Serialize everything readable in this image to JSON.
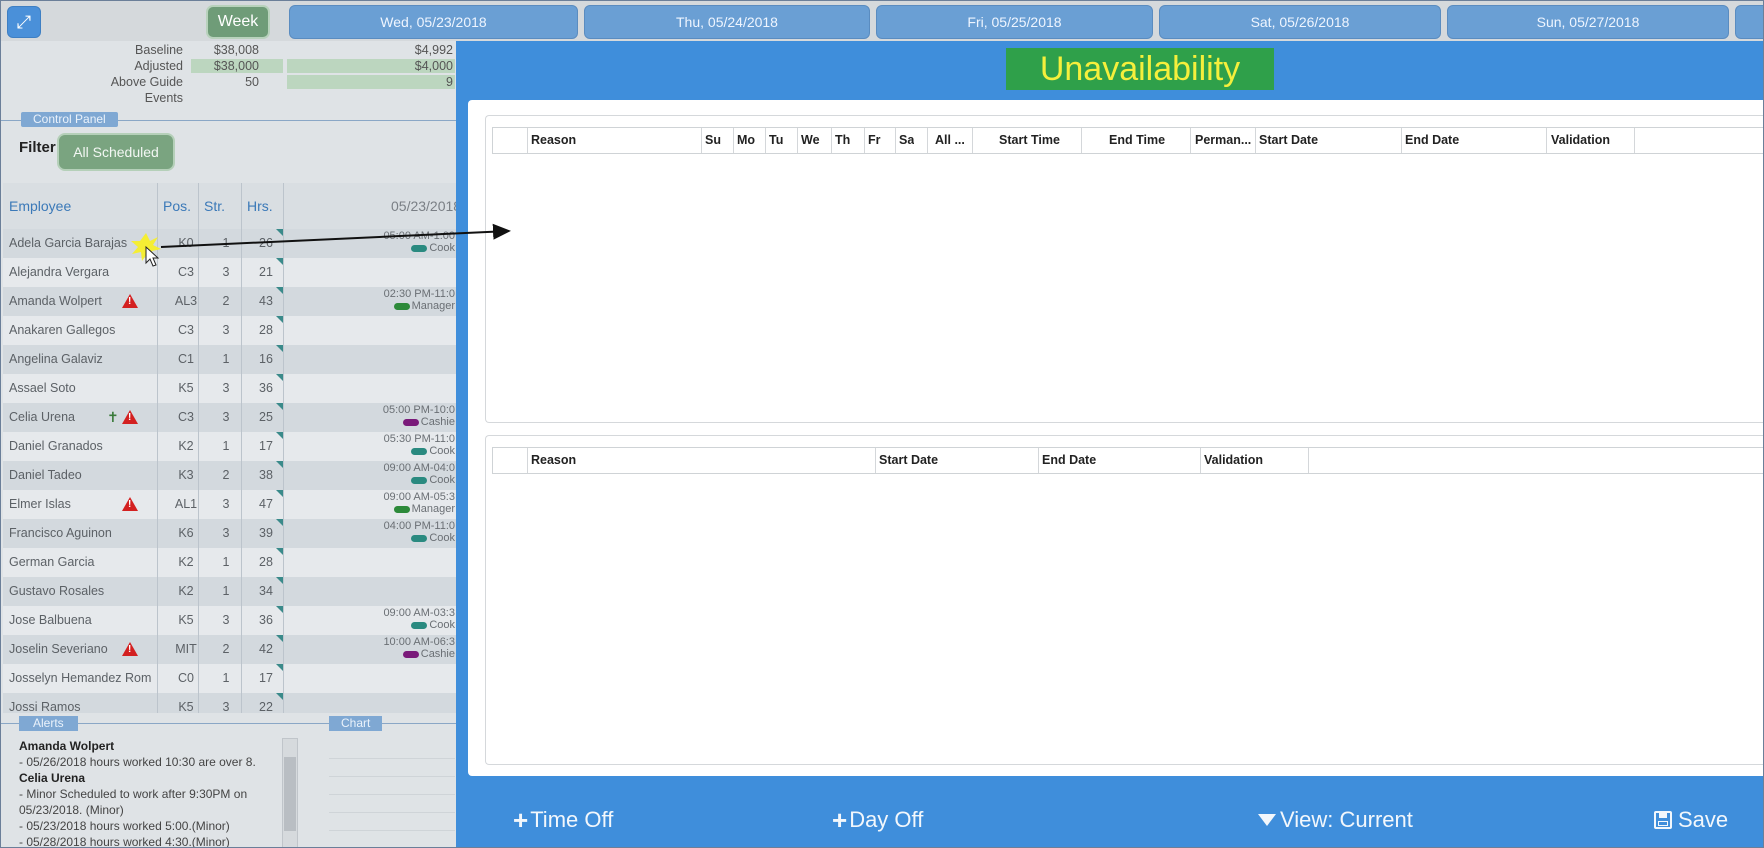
{
  "topbar": {
    "expand_icon": "expand-icon",
    "week_label": "Week",
    "days": [
      "Wed, 05/23/2018",
      "Thu, 05/24/2018",
      "Fri, 05/25/2018",
      "Sat, 05/26/2018",
      "Sun, 05/27/2018"
    ]
  },
  "summary": {
    "labels": [
      "Baseline",
      "Adjusted",
      "Above Guide",
      "Events"
    ],
    "col1": [
      "$38,008",
      "$38,000",
      "50",
      ""
    ],
    "col2": [
      "$4,992",
      "$4,000",
      "9",
      ""
    ]
  },
  "control_panel": {
    "title": "Control Panel",
    "filter_label": "Filter",
    "filter_value": "All Scheduled"
  },
  "grid": {
    "headers": {
      "employee": "Employee",
      "pos": "Pos.",
      "str": "Str.",
      "hrs": "Hrs.",
      "date": "05/23/2018"
    },
    "rows": [
      {
        "name": "Adela Garcia Barajas",
        "pos": "K0",
        "str": "1",
        "hrs": "26",
        "time": "05:00 AM-1:00",
        "role": "Cook",
        "role_color": "#2a8a80"
      },
      {
        "name": "Alejandra Vergara",
        "pos": "C3",
        "str": "3",
        "hrs": "21",
        "time": "",
        "role": ""
      },
      {
        "name": "Amanda Wolpert",
        "pos": "AL3",
        "str": "2",
        "hrs": "43",
        "time": "02:30 PM-11:0",
        "role": "Manager",
        "role_color": "#2d8a3a"
      },
      {
        "name": "Anakaren Gallegos",
        "pos": "C3",
        "str": "3",
        "hrs": "28",
        "time": "",
        "role": ""
      },
      {
        "name": "Angelina Galaviz",
        "pos": "C1",
        "str": "1",
        "hrs": "16",
        "time": "",
        "role": ""
      },
      {
        "name": "Assael Soto",
        "pos": "K5",
        "str": "3",
        "hrs": "36",
        "time": "",
        "role": ""
      },
      {
        "name": "Celia Urena",
        "pos": "C3",
        "str": "3",
        "hrs": "25",
        "time": "05:00 PM-10:0",
        "role": "Cashie",
        "role_color": "#7a1a7a"
      },
      {
        "name": "Daniel Granados",
        "pos": "K2",
        "str": "1",
        "hrs": "17",
        "time": "05:30 PM-11:0",
        "role": "Cook",
        "role_color": "#2a8a80"
      },
      {
        "name": "Daniel Tadeo",
        "pos": "K3",
        "str": "2",
        "hrs": "38",
        "time": "09:00 AM-04:0",
        "role": "Cook",
        "role_color": "#2a8a80"
      },
      {
        "name": "Elmer Islas",
        "pos": "AL1",
        "str": "3",
        "hrs": "47",
        "time": "09:00 AM-05:3",
        "role": "Manager",
        "role_color": "#2d8a3a"
      },
      {
        "name": "Francisco Aguinon",
        "pos": "K6",
        "str": "3",
        "hrs": "39",
        "time": "04:00 PM-11:0",
        "role": "Cook",
        "role_color": "#2a8a80"
      },
      {
        "name": "German Garcia",
        "pos": "K2",
        "str": "1",
        "hrs": "28",
        "time": "",
        "role": ""
      },
      {
        "name": "Gustavo Rosales",
        "pos": "K2",
        "str": "1",
        "hrs": "34",
        "time": "",
        "role": ""
      },
      {
        "name": "Jose Balbuena",
        "pos": "K5",
        "str": "3",
        "hrs": "36",
        "time": "09:00 AM-03:3",
        "role": "Cook",
        "role_color": "#2a8a80"
      },
      {
        "name": "Joselin Severiano",
        "pos": "MIT",
        "str": "2",
        "hrs": "42",
        "time": "10:00 AM-06:3",
        "role": "Cashie",
        "role_color": "#7a1a7a"
      },
      {
        "name": "Josselyn Hemandez Rom",
        "pos": "C0",
        "str": "1",
        "hrs": "17",
        "time": "",
        "role": ""
      },
      {
        "name": "Jossi Ramos",
        "pos": "K5",
        "str": "3",
        "hrs": "22",
        "time": "",
        "role": ""
      }
    ]
  },
  "alerts": {
    "title": "Alerts",
    "chart_title": "Chart",
    "lines": [
      {
        "text": "Amanda Wolpert",
        "bold": true
      },
      {
        "text": "- 05/26/2018 hours worked 10:30 are over 8.",
        "bold": false
      },
      {
        "text": "Celia Urena",
        "bold": true
      },
      {
        "text": "- Minor Scheduled to work after 9:30PM on",
        "bold": false
      },
      {
        "text": "05/23/2018. (Minor)",
        "bold": false
      },
      {
        "text": "- 05/23/2018 hours worked 5:00.(Minor)",
        "bold": false
      },
      {
        "text": "- 05/28/2018 hours worked 4:30.(Minor)",
        "bold": false
      }
    ]
  },
  "modal": {
    "title": "Unavailability",
    "top_table_headers": [
      "Reason",
      "Su",
      "Mo",
      "Tu",
      "We",
      "Th",
      "Fr",
      "Sa",
      "All ...",
      "Start Time",
      "End Time",
      "Perman...",
      "Start Date",
      "End Date",
      "Validation"
    ],
    "bottom_table_headers": [
      "Reason",
      "Start Date",
      "End Date",
      "Validation"
    ],
    "buttons": {
      "time_off": "Time Off",
      "day_off": "Day Off",
      "view": "View: Current",
      "save": "Save"
    }
  }
}
